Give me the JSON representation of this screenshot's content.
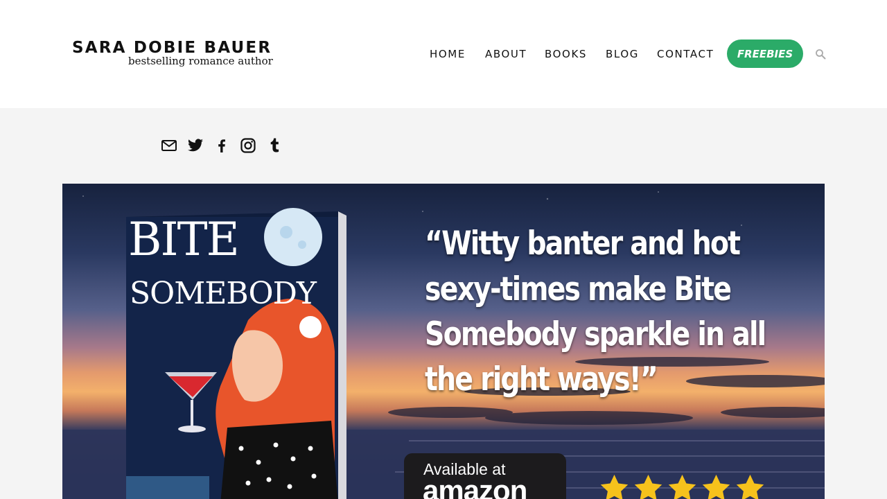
{
  "site": {
    "author_name": "SARA DOBIE BAUER",
    "tagline": "bestselling romance author"
  },
  "nav": {
    "items": [
      {
        "label": "HOME"
      },
      {
        "label": "ABOUT"
      },
      {
        "label": "BOOKS"
      },
      {
        "label": "BLOG"
      },
      {
        "label": "CONTACT"
      }
    ],
    "cta_label": "FREEBIES",
    "search_icon": "search-icon"
  },
  "social": {
    "icons": [
      "email-icon",
      "twitter-icon",
      "facebook-icon",
      "instagram-icon",
      "tumblr-icon"
    ]
  },
  "hero": {
    "book_title_line1": "BITE",
    "book_title_line2": "SOMEBODY",
    "quote_lines": [
      "“Witty banter and hot",
      "sexy-times make Bite",
      "Somebody sparkle in all",
      "the right ways!”"
    ],
    "store_prefix": "Available at",
    "store_name": "amazon",
    "rating": 5,
    "rating_max": 5
  },
  "colors": {
    "accent": "#2bab68",
    "star": "#f6c21c",
    "band": "#f4f4f4"
  }
}
